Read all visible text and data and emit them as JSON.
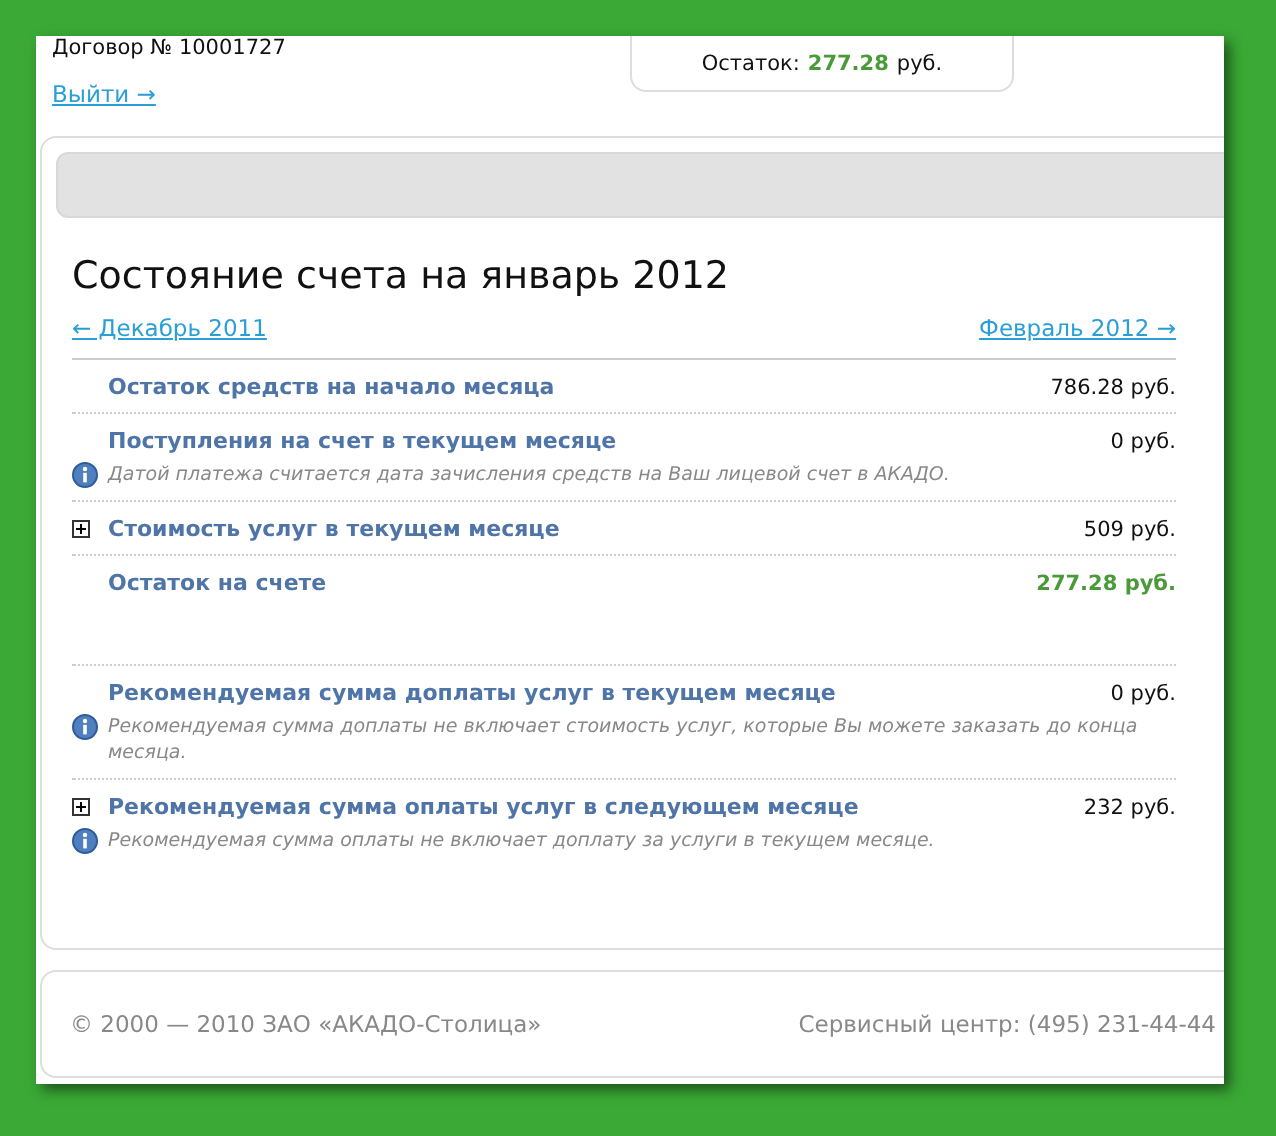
{
  "header": {
    "contract": "Договор № 10001727",
    "logout_link": "Выйти →",
    "balance_label": "Остаток:",
    "balance_value": "277.28",
    "balance_unit": "руб."
  },
  "account": {
    "title": "Состояние счета на январь 2012",
    "prev_link": "← Декабрь 2011",
    "next_link": "Февраль 2012 →",
    "rows": [
      {
        "label": "Остаток средств на начало месяца",
        "amount": "786.28 руб.",
        "expandable": false,
        "highlight": false
      },
      {
        "label": "Поступления на счет в текущем месяце",
        "amount": "0 руб.",
        "expandable": false,
        "highlight": false,
        "note": "Датой платежа считается дата зачисления средств на Ваш лицевой счет в АКАДО."
      },
      {
        "label": "Стоимость услуг в текущем месяце",
        "amount": "509 руб.",
        "expandable": true,
        "highlight": false
      },
      {
        "label": "Остаток на счете",
        "amount": "277.28 руб.",
        "expandable": false,
        "highlight": true
      },
      {
        "label": "Рекомендуемая сумма доплаты услуг в текущем месяце",
        "amount": "0 руб.",
        "expandable": false,
        "highlight": false,
        "note": "Рекомендуемая сумма доплаты не включает стоимость услуг, которые Вы можете заказать до конца месяца."
      },
      {
        "label": "Рекомендуемая сумма оплаты услуг в следующем месяце",
        "amount": "232 руб.",
        "expandable": true,
        "highlight": false,
        "note": "Рекомендуемая сумма оплаты не включает доплату за услуги в текущем месяце."
      }
    ]
  },
  "footer": {
    "copyright": "© 2000 — 2010 ЗАО «АКАДО-Столица»",
    "service": "Сервисный центр: (495) 231-44-44"
  }
}
